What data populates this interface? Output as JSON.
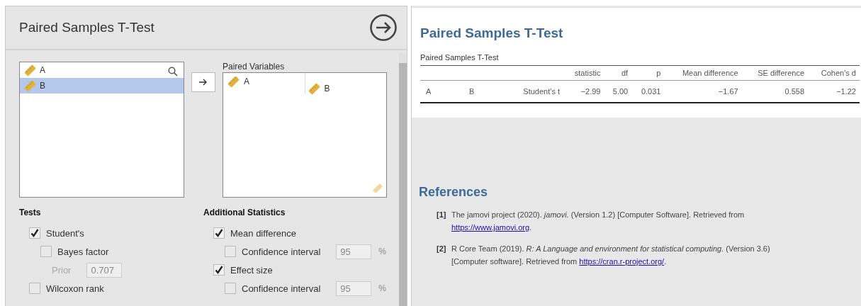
{
  "analysis_panel": {
    "title": "Paired Samples T-Test",
    "variables": [
      {
        "name": "A",
        "selected": false
      },
      {
        "name": "B",
        "selected": true
      }
    ],
    "paired_variables": {
      "label": "Paired Variables",
      "pairs": [
        {
          "first": "A",
          "second": "B"
        }
      ]
    },
    "tests": {
      "heading": "Tests",
      "options": [
        {
          "kind": "checkbox",
          "label": "Student's",
          "checked": true,
          "children": [
            {
              "kind": "checkbox",
              "label": "Bayes factor",
              "checked": false,
              "children": [
                {
                  "kind": "field",
                  "label": "Prior",
                  "value": "0.707",
                  "disabled": true
                }
              ]
            }
          ]
        },
        {
          "kind": "checkbox",
          "label": "Wilcoxon rank",
          "checked": false
        }
      ]
    },
    "additional_statistics": {
      "heading": "Additional Statistics",
      "options": [
        {
          "kind": "checkbox",
          "label": "Mean difference",
          "checked": true,
          "children": [
            {
              "kind": "checkbox",
              "label": "Confidence interval",
              "checked": false,
              "value": "95",
              "unit": "%"
            }
          ]
        },
        {
          "kind": "checkbox",
          "label": "Effect size",
          "checked": true,
          "children": [
            {
              "kind": "checkbox",
              "label": "Confidence interval",
              "checked": false,
              "value": "95",
              "unit": "%"
            }
          ]
        }
      ]
    }
  },
  "results": {
    "title": "Paired Samples T-Test",
    "table": {
      "caption": "Paired Samples T-Test",
      "columns": [
        "",
        "",
        "",
        "statistic",
        "df",
        "p",
        "Mean difference",
        "SE difference",
        "Cohen's d"
      ],
      "rows": [
        {
          "cells": [
            "A",
            "B",
            "Student's t",
            "−2.99",
            "5.00",
            "0.031",
            "−1.67",
            "0.558",
            "−1.22"
          ]
        }
      ]
    },
    "references": {
      "heading": "References",
      "items": [
        {
          "number": "[1]",
          "text": "The jamovi project (2020). *jamovi.* (Version 1.2) [Computer Software]. Retrieved from",
          "link": "https://www.jamovi.org",
          "after": "."
        },
        {
          "number": "[2]",
          "text": "R Core Team (2019). *R: A Language and environment for statistical computing.* (Version 3.6) [Computer software]. Retrieved from",
          "link": "https://cran.r-project.org/",
          "after": "."
        }
      ]
    }
  }
}
